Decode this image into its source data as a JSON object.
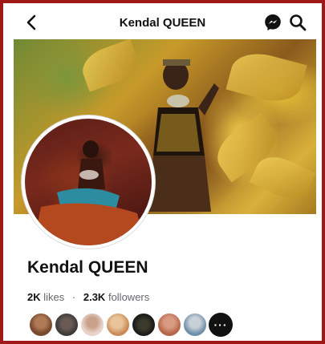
{
  "header": {
    "title": "Kendal QUEEN",
    "back_icon": "back-arrow-icon",
    "messenger_icon": "messenger-icon",
    "search_icon": "search-icon"
  },
  "profile": {
    "name": "Kendal QUEEN",
    "likes_count": "2K",
    "likes_label": "likes",
    "separator": "·",
    "followers_count": "2.3K",
    "followers_label": "followers"
  },
  "friends": {
    "more_label": "···",
    "avatar_colors": [
      "#7a4a2e",
      "#3d3a3a",
      "#e7d3c8",
      "#c98a55",
      "#1a1a1a",
      "#b5654a",
      "#6f8fa8"
    ]
  },
  "colors": {
    "frame_border": "#a01818",
    "text_primary": "#111111",
    "text_secondary": "#65676b"
  }
}
